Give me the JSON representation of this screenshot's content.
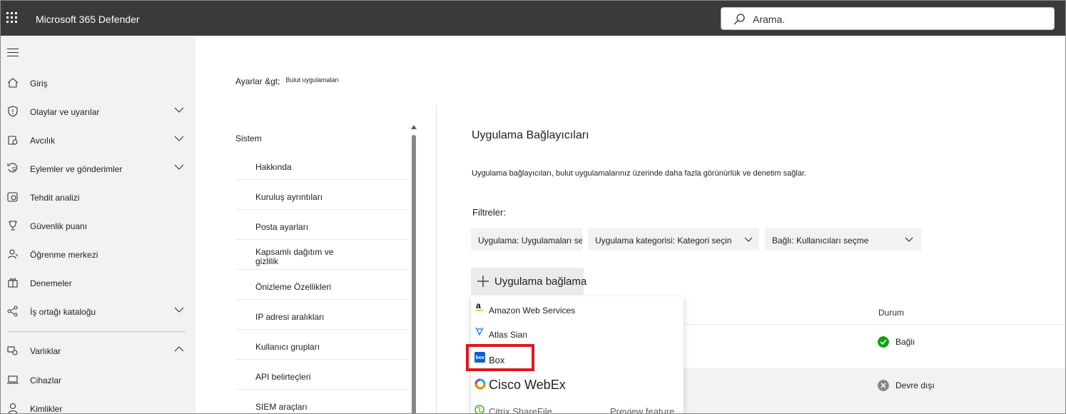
{
  "app": {
    "title": "Microsoft 365 Defender"
  },
  "search": {
    "placeholder": "Arama."
  },
  "sidebar": {
    "items": [
      {
        "label": "Giriş",
        "icon": "home-icon",
        "expandable": false
      },
      {
        "label": "Olaylar ve uyarılar",
        "icon": "shield-icon",
        "expandable": true
      },
      {
        "label": "Avcılık",
        "icon": "hunting-icon",
        "expandable": true
      },
      {
        "label": "Eylemler ve gönderimler",
        "icon": "actions-icon",
        "expandable": true
      },
      {
        "label": "Tehdit analizi",
        "icon": "threat-analytics-icon",
        "expandable": false
      },
      {
        "label": "Güvenlik puanı",
        "icon": "trophy-icon",
        "expandable": false
      },
      {
        "label": "Öğrenme merkezi",
        "icon": "learning-icon",
        "expandable": false
      },
      {
        "label": "Denemeler",
        "icon": "trials-icon",
        "expandable": false
      },
      {
        "label": "İş ortağı kataloğu",
        "icon": "partner-catalog-icon",
        "expandable": true
      },
      {
        "label": "Varlıklar",
        "icon": "assets-icon",
        "expandable": true,
        "expanded": true
      },
      {
        "label": "Cihazlar",
        "icon": "device-icon",
        "expandable": false
      },
      {
        "label": "Kimlikler",
        "icon": "identity-icon",
        "expandable": false
      }
    ]
  },
  "breadcrumb": {
    "root": "Ayarlar &gt;",
    "current": "Bulut uygulamaları"
  },
  "settings_nav": {
    "section": "Sistem",
    "items": [
      "Hakkında",
      "Kuruluş ayrıntıları",
      "Posta ayarları",
      "Kapsamlı dağıtım ve gizlilik",
      "Önizleme Özellikleri",
      "IP adresi aralıkları",
      "Kullanıcı grupları",
      "API belirteçleri",
      "SIEM araçları"
    ]
  },
  "main": {
    "title": "Uygulama Bağlayıcıları",
    "description": "Uygulama bağlayıcıları, bulut uygulamalarınız üzerinde daha fazla görünürlük ve denetim sağlar.",
    "filters_label": "Filtreler:",
    "filters": [
      "Uygulama: Uygulamaları seçme",
      "Uygulama kategorisi: Kategori seçin",
      "Bağlı: Kullanıcıları seçme"
    ],
    "connect_button": "Uygulama bağlama",
    "status_header": "Durum",
    "rows": [
      {
        "status": "Bağlı",
        "status_color": "#13a10e"
      },
      {
        "status": "Devre dışı",
        "status_color": "#8a8886"
      }
    ]
  },
  "dropdown": {
    "items": [
      {
        "label": "Amazon Web Services",
        "icon": "amazon-icon"
      },
      {
        "label": "Atlas Sian",
        "icon": "atlassian-icon"
      },
      {
        "label": "Box",
        "icon": "box-icon",
        "highlighted": true
      },
      {
        "label": "Cisco WebEx",
        "icon": "webex-icon"
      },
      {
        "label": "Citrix ShareFile",
        "icon": "sharefile-icon",
        "note": "Preview feature"
      }
    ]
  },
  "colors": {
    "topbar": "#3b3a39",
    "sidebar": "#f3f2f1",
    "highlight": "#e0161d",
    "box_brand": "#0061d5"
  }
}
